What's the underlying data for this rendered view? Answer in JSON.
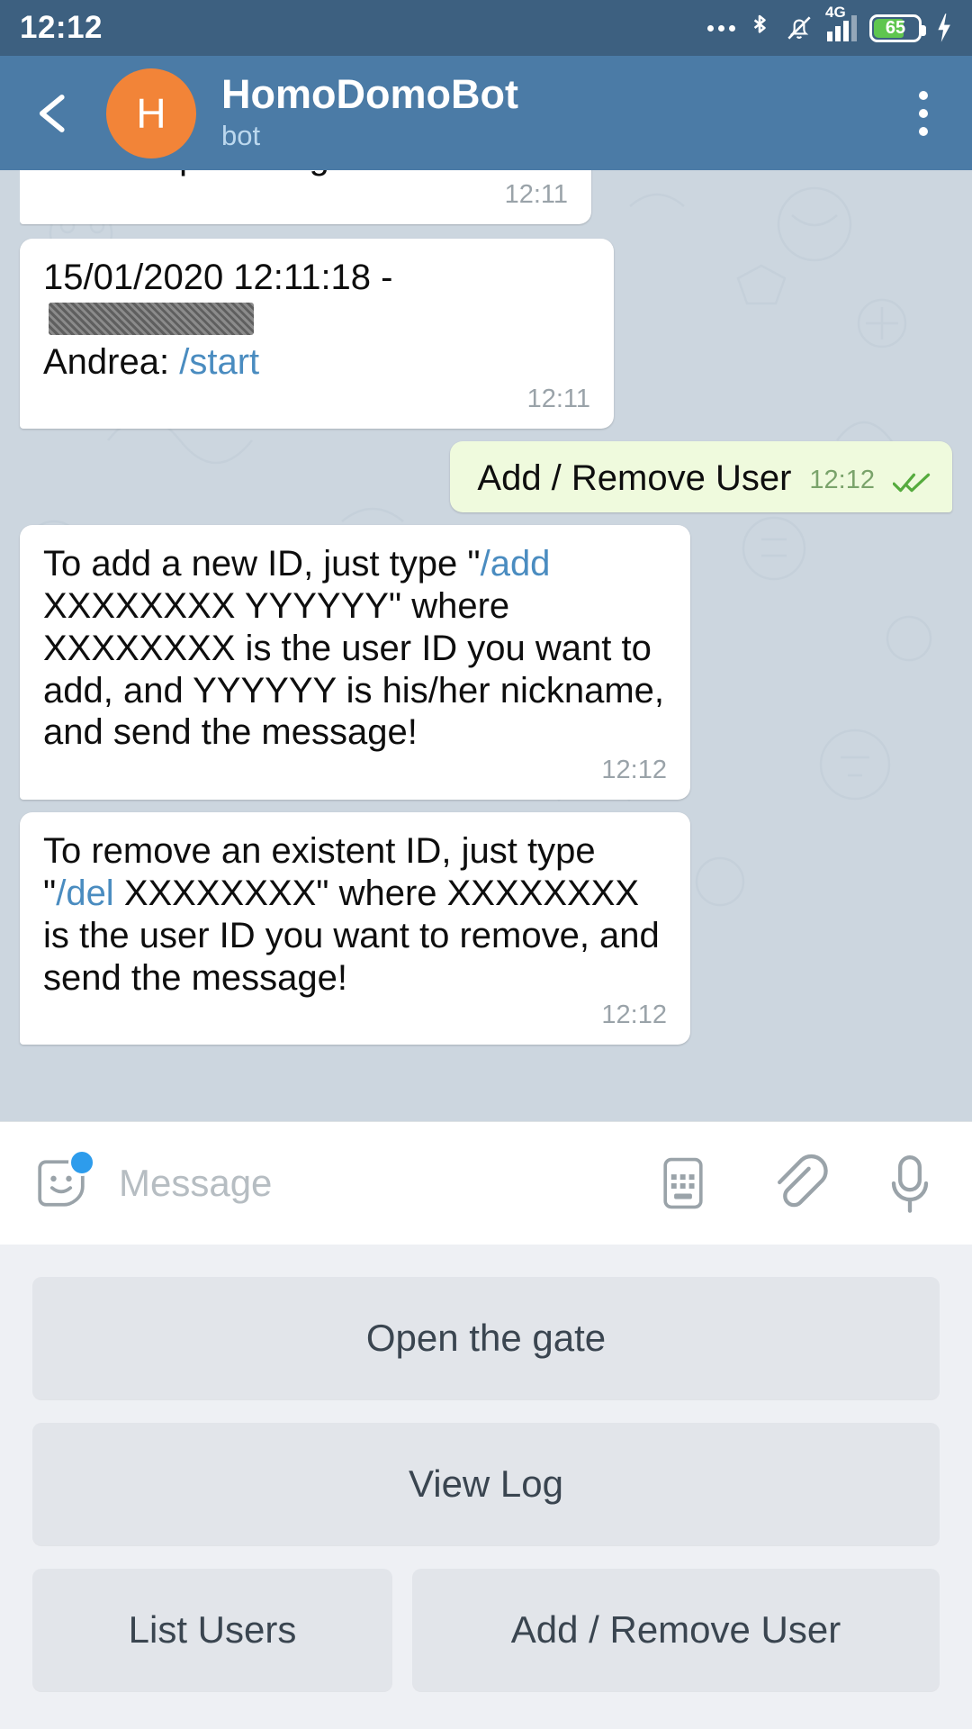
{
  "status_bar": {
    "time": "12:12",
    "battery_percent": "65",
    "network": "4G",
    "icons": [
      "more-dots-icon",
      "bluetooth-icon",
      "mute-bell-icon",
      "signal-icon",
      "battery-icon",
      "charging-bolt-icon"
    ]
  },
  "header": {
    "back_label": "back-arrow",
    "avatar_letter": "H",
    "title": "HomoDomoBot",
    "subtitle": "bot",
    "menu_label": "more-options"
  },
  "messages": [
    {
      "id": "m1",
      "side": "in",
      "clipped": true,
      "text": "Mirco: Open the gate",
      "time": "12:11"
    },
    {
      "id": "m2",
      "side": "in",
      "line1_prefix": "15/01/2020 12:11:18 - ",
      "line1_redacted": true,
      "line2_name": "Andrea: ",
      "line2_command": "/start",
      "time": "12:11"
    },
    {
      "id": "m3",
      "side": "out",
      "text": "Add / Remove User",
      "time": "12:12",
      "status": "read"
    },
    {
      "id": "m4",
      "side": "in",
      "text_before": "To add a new ID, just type \"",
      "command": "/add",
      "text_after": " XXXXXXXX YYYYYY\" where XXXXXXXX is the user ID you want to add, and YYYYYY is his/her nickname, and send the message!",
      "time": "12:12"
    },
    {
      "id": "m5",
      "side": "in",
      "text_before": "To remove an existent ID, just type \"",
      "command": "/del",
      "text_after": " XXXXXXXX\" where XXXXXXXX is the user ID you want to remove, and send the message!",
      "time": "12:12"
    }
  ],
  "input_bar": {
    "placeholder": "Message",
    "value": "",
    "icons": [
      "sticker-smiley-icon",
      "keyboard-icon",
      "paperclip-icon",
      "microphone-icon"
    ]
  },
  "keyboard": {
    "rows": [
      [
        {
          "label": "Open the gate"
        }
      ],
      [
        {
          "label": "View Log"
        }
      ],
      [
        {
          "label": "List Users"
        },
        {
          "label": "Add / Remove User"
        }
      ]
    ]
  },
  "colors": {
    "status_bar": "#3d6080",
    "header": "#4b7ba6",
    "avatar": "#f28438",
    "chat_bg": "#ccd6df",
    "bubble_in": "#ffffff",
    "bubble_out": "#effadd",
    "link": "#4a8cc0",
    "keyboard_bg": "#eef0f4",
    "key_bg": "#e2e5ea",
    "tick": "#55ab3d",
    "badge": "#2d9cec"
  }
}
